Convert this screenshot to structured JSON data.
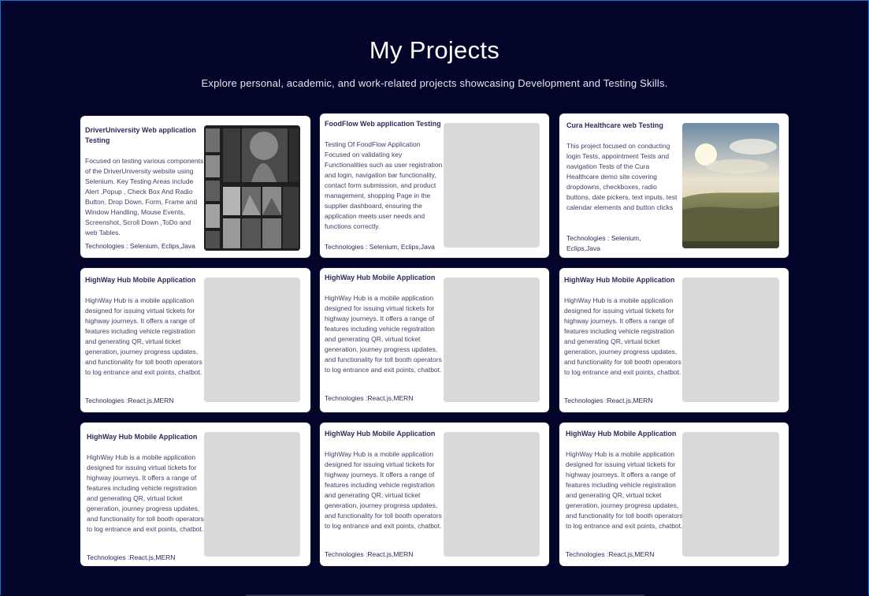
{
  "page": {
    "title": "My Projects",
    "subtitle": "Explore personal, academic, and work-related projects showcasing Development and Testing Skills."
  },
  "projects": [
    {
      "title": "DriverUniversity Web application Testing",
      "description": "Focused on testing various components of the DriverUniversity website using Selenium. Key Testing Areas  include Alert ,Popup , Check Box And Radio Button, Drop Down, Form, Frame and Window Handling, Mouse Events, Screenshot, Scroll Down ,ToDo and web Tables.",
      "technologies": "Technologies : Selenium, Eclips,Java",
      "image": "monochrome-landscape-gallery-thumbnail"
    },
    {
      "title": "FoodFlow Web application Testing",
      "description": "Testing Of FoodFlow Application Focused on validating key Functionalities such as user registration and login, navigation bar functionality, contact form submission, and product management, shopping Page in the supplier dashboard, ensuring the application meets user needs and functions correctly.",
      "technologies": "Technologies : Selenium, Eclips,Java",
      "image": "placeholder"
    },
    {
      "title": "Cura Healthcare web Testing",
      "description": "This project focused on conducting login Tests, appointment Tests and navigation Tests of the Cura Healthcare demo site covering dropdowns, checkboxes, radio buttons, date pickers, text inputs, test calendar elements and button clicks",
      "technologies": "Technologies : Selenium, Eclips,Java",
      "image": "sunlit-valley-thumbnail"
    },
    {
      "title": "HighWay Hub Mobile Application",
      "description": "HighWay Hub is a mobile application designed for issuing virtual tickets for highway journeys. It offers a range of features including vehicle registration and generating QR, virtual ticket generation, journey progress updates, and functionality for toll booth operators to log entrance and exit points, chatbot.",
      "technologies": "Technologies :React.js,MERN",
      "image": "placeholder"
    },
    {
      "title": "HighWay Hub Mobile Application",
      "description": "HighWay Hub is a mobile application designed for issuing virtual tickets for highway journeys. It offers a range of features including vehicle registration and generating QR, virtual ticket generation, journey progress updates, and functionality for toll booth operators to log entrance and exit points, chatbot.",
      "technologies": "Technologies :React.js,MERN",
      "image": "placeholder"
    },
    {
      "title": "HighWay Hub Mobile Application",
      "description": "HighWay Hub is a mobile application designed for issuing virtual tickets for highway journeys. It offers a range of features including vehicle registration and generating QR, virtual ticket generation, journey progress updates, and functionality for toll booth operators to log entrance and exit points, chatbot.",
      "technologies": "Technologies :React.js,MERN",
      "image": "placeholder"
    },
    {
      "title": "HighWay Hub Mobile Application",
      "description": "HighWay Hub is a mobile application designed for issuing virtual tickets for highway journeys. It offers a range of features including vehicle registration and generating QR, virtual ticket generation, journey progress updates, and functionality for toll booth operators to log entrance and exit points, chatbot.",
      "technologies": "Technologies :React.js,MERN",
      "image": "placeholder"
    },
    {
      "title": "HighWay Hub Mobile Application",
      "description": "HighWay Hub is a mobile application designed for issuing virtual tickets for highway journeys. It offers a range of features including vehicle registration and generating QR, virtual ticket generation, journey progress updates, and functionality for toll booth operators to log entrance and exit points, chatbot.",
      "technologies": "Technologies :React.js,MERN",
      "image": "placeholder"
    },
    {
      "title": "HighWay Hub Mobile Application",
      "description": "HighWay Hub is a mobile application designed for issuing virtual tickets for highway journeys. It offers a range of features including vehicle registration and generating QR, virtual ticket generation, journey progress updates, and functionality for toll booth operators to log entrance and exit points, chatbot.",
      "technologies": "Technologies :React.js,MERN",
      "image": "placeholder"
    }
  ],
  "colors": {
    "background": "#03042a",
    "card": "#ffffff",
    "placeholder": "#d9d9d9",
    "title_text": "#ffffff"
  }
}
